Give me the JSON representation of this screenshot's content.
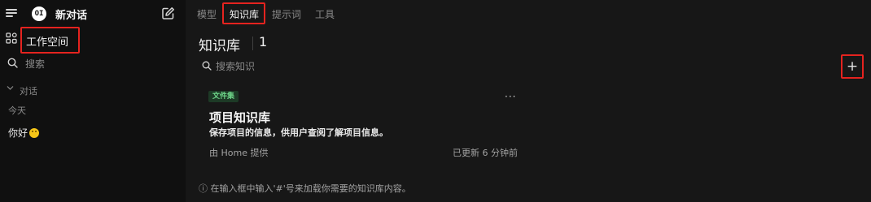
{
  "sidebar": {
    "menu_icon": "hamburger-icon",
    "logo_text": "OI",
    "new_chat": "新对话",
    "edit_icon": "pencil-square-icon",
    "workspace_icon": "grid-icon",
    "workspace": "工作空间",
    "search_icon": "search-icon",
    "search": "搜索",
    "section_chevron": "chevron-down-icon",
    "conversations": "对话",
    "today": "今天",
    "chat_item": "你好",
    "chat_item_emoji": "smiling-face-emoji"
  },
  "tabs": [
    "模型",
    "知识库",
    "提示词",
    "工具"
  ],
  "active_tab": "知识库",
  "knowledge": {
    "title": "知识库",
    "count": "1",
    "search_placeholder": "搜索知识",
    "add_label": "+"
  },
  "card": {
    "badge": "文件集",
    "more": "···",
    "title": "项目知识库",
    "description": "保存项目的信息，供用户查阅了解项目信息。",
    "provider": "由 Home 提供",
    "updated": "已更新 6 分钟前"
  },
  "hint": "ⓘ 在输入框中输入'#'号来加载你需要的知识库内容。",
  "colors": {
    "background": "#171717",
    "sidebar_background": "#101010",
    "highlight": "#e5231f",
    "badge_bg": "#1d3a26",
    "badge_text": "#6fd68a"
  }
}
